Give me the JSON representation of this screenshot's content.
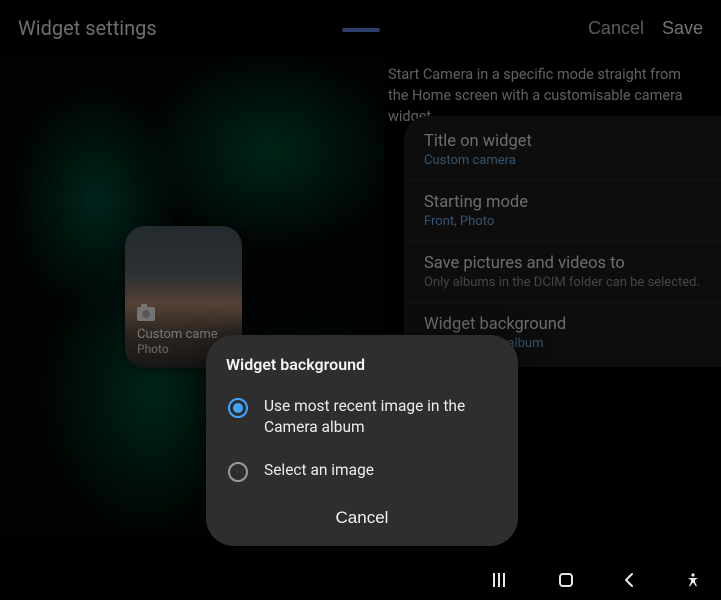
{
  "header": {
    "title": "Widget settings",
    "cancel": "Cancel",
    "save": "Save"
  },
  "description": "Start Camera in a specific mode straight from the Home screen with a customisable camera widget.",
  "widget_preview": {
    "title": "Custom came",
    "subtitle": "Photo"
  },
  "settings": [
    {
      "label": "Title on widget",
      "value": "Custom camera",
      "hint": ""
    },
    {
      "label": "Starting mode",
      "value": "Front, Photo",
      "hint": ""
    },
    {
      "label": "Save pictures and videos to",
      "value": "",
      "hint": "Only albums in the DCIM folder can be selected."
    },
    {
      "label": "Widget background",
      "value": "in the Camera album",
      "hint": ""
    }
  ],
  "dialog": {
    "title": "Widget background",
    "options": [
      {
        "label": "Use most recent image in the Camera album",
        "checked": true
      },
      {
        "label": "Select an image",
        "checked": false
      }
    ],
    "cancel": "Cancel"
  }
}
